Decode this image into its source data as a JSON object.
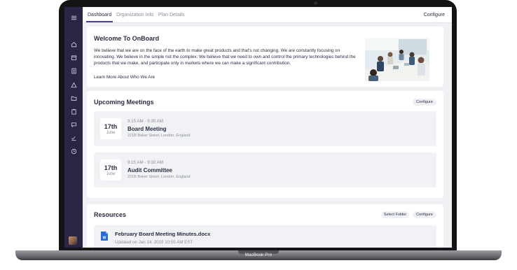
{
  "device": {
    "label": "MacBook Pro"
  },
  "sidebar": {
    "icons": [
      "menu-icon",
      "home-icon",
      "calendar-icon",
      "document-icon",
      "alert-icon",
      "folder-icon",
      "clipboard-icon",
      "chat-icon",
      "checklist-icon",
      "clock-icon"
    ]
  },
  "header": {
    "tabs": [
      {
        "label": "Dashboard",
        "active": true
      },
      {
        "label": "Organization Info",
        "active": false
      },
      {
        "label": "Plan Details",
        "active": false
      }
    ],
    "configure_label": "Configure"
  },
  "welcome": {
    "title": "Welcome To OnBoard",
    "body": "We believe that we are on the face of the earth to make great products and that's not changing. We are constantly focusing on innovating. We believe in the simple not the complex. We believe that we need to own and control the primary technologies behind the products that we make, and participate only in markets where we can make a significant contribution.",
    "link": "Learn More About Who We Are"
  },
  "meetings": {
    "title": "Upcoming Meetings",
    "configure_label": "Configure",
    "items": [
      {
        "day": "17th",
        "month": "June",
        "time": "9:15 AM - 9:30 AM",
        "title": "Board Meeting",
        "address": "221B Baker Street, London, England"
      },
      {
        "day": "17th",
        "month": "June",
        "time": "9:15 AM - 9:30 AM",
        "title": "Audit Committee",
        "address": "221B Baker Street, London, England"
      }
    ]
  },
  "resources": {
    "title": "Resources",
    "select_folder_label": "Select Folder",
    "configure_label": "Configure",
    "items": [
      {
        "name": "February Board Meeting Minutes.docx",
        "meta": "Updated on Jan 14, 2019 10:55 AM EST",
        "icon": "word-document-icon"
      }
    ]
  },
  "colors": {
    "sidebar": "#2a2445",
    "accent": "#4a3f8f",
    "background": "#eff1f5",
    "text": "#2b2d42",
    "muted": "#8a8c9b",
    "word_blue": "#2b6cd4"
  }
}
